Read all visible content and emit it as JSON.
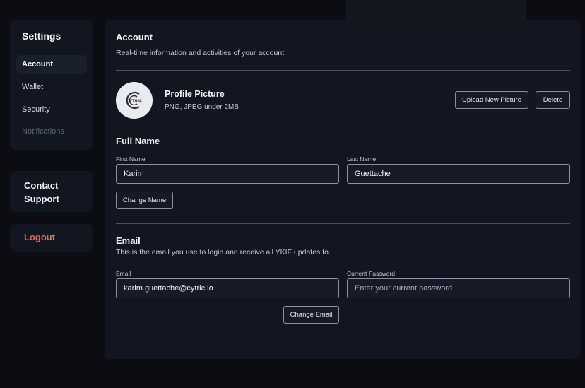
{
  "sidebar": {
    "title": "Settings",
    "items": [
      {
        "label": "Account"
      },
      {
        "label": "Wallet"
      },
      {
        "label": "Security"
      },
      {
        "label": "Notifications"
      }
    ],
    "support_label": "Contact Support",
    "logout_label": "Logout"
  },
  "account": {
    "title": "Account",
    "subtitle": "Real-time information and activities of your account."
  },
  "profile": {
    "avatar_text": "CYTRIC",
    "title": "Profile Picture",
    "hint": "PNG, JPEG under 2MB",
    "upload_label": "Upload New Picture",
    "delete_label": "Delete"
  },
  "full_name": {
    "title": "Full Name",
    "first_label": "First Name",
    "first_value": "Karim",
    "last_label": "Last Name",
    "last_value": "Guettache",
    "change_label": "Change Name"
  },
  "email_section": {
    "title": "Email",
    "subtitle": "This is the email you use to login and receive all YKIF updates to.",
    "email_label": "Email",
    "email_value": "karim.guettache@cytric.io",
    "password_label": "Current Password",
    "password_placeholder": "Enter your current password",
    "change_label": "Change Email"
  },
  "colors": {
    "background": "#0b0d12",
    "panel": "#121621",
    "logout": "#e3675a"
  }
}
